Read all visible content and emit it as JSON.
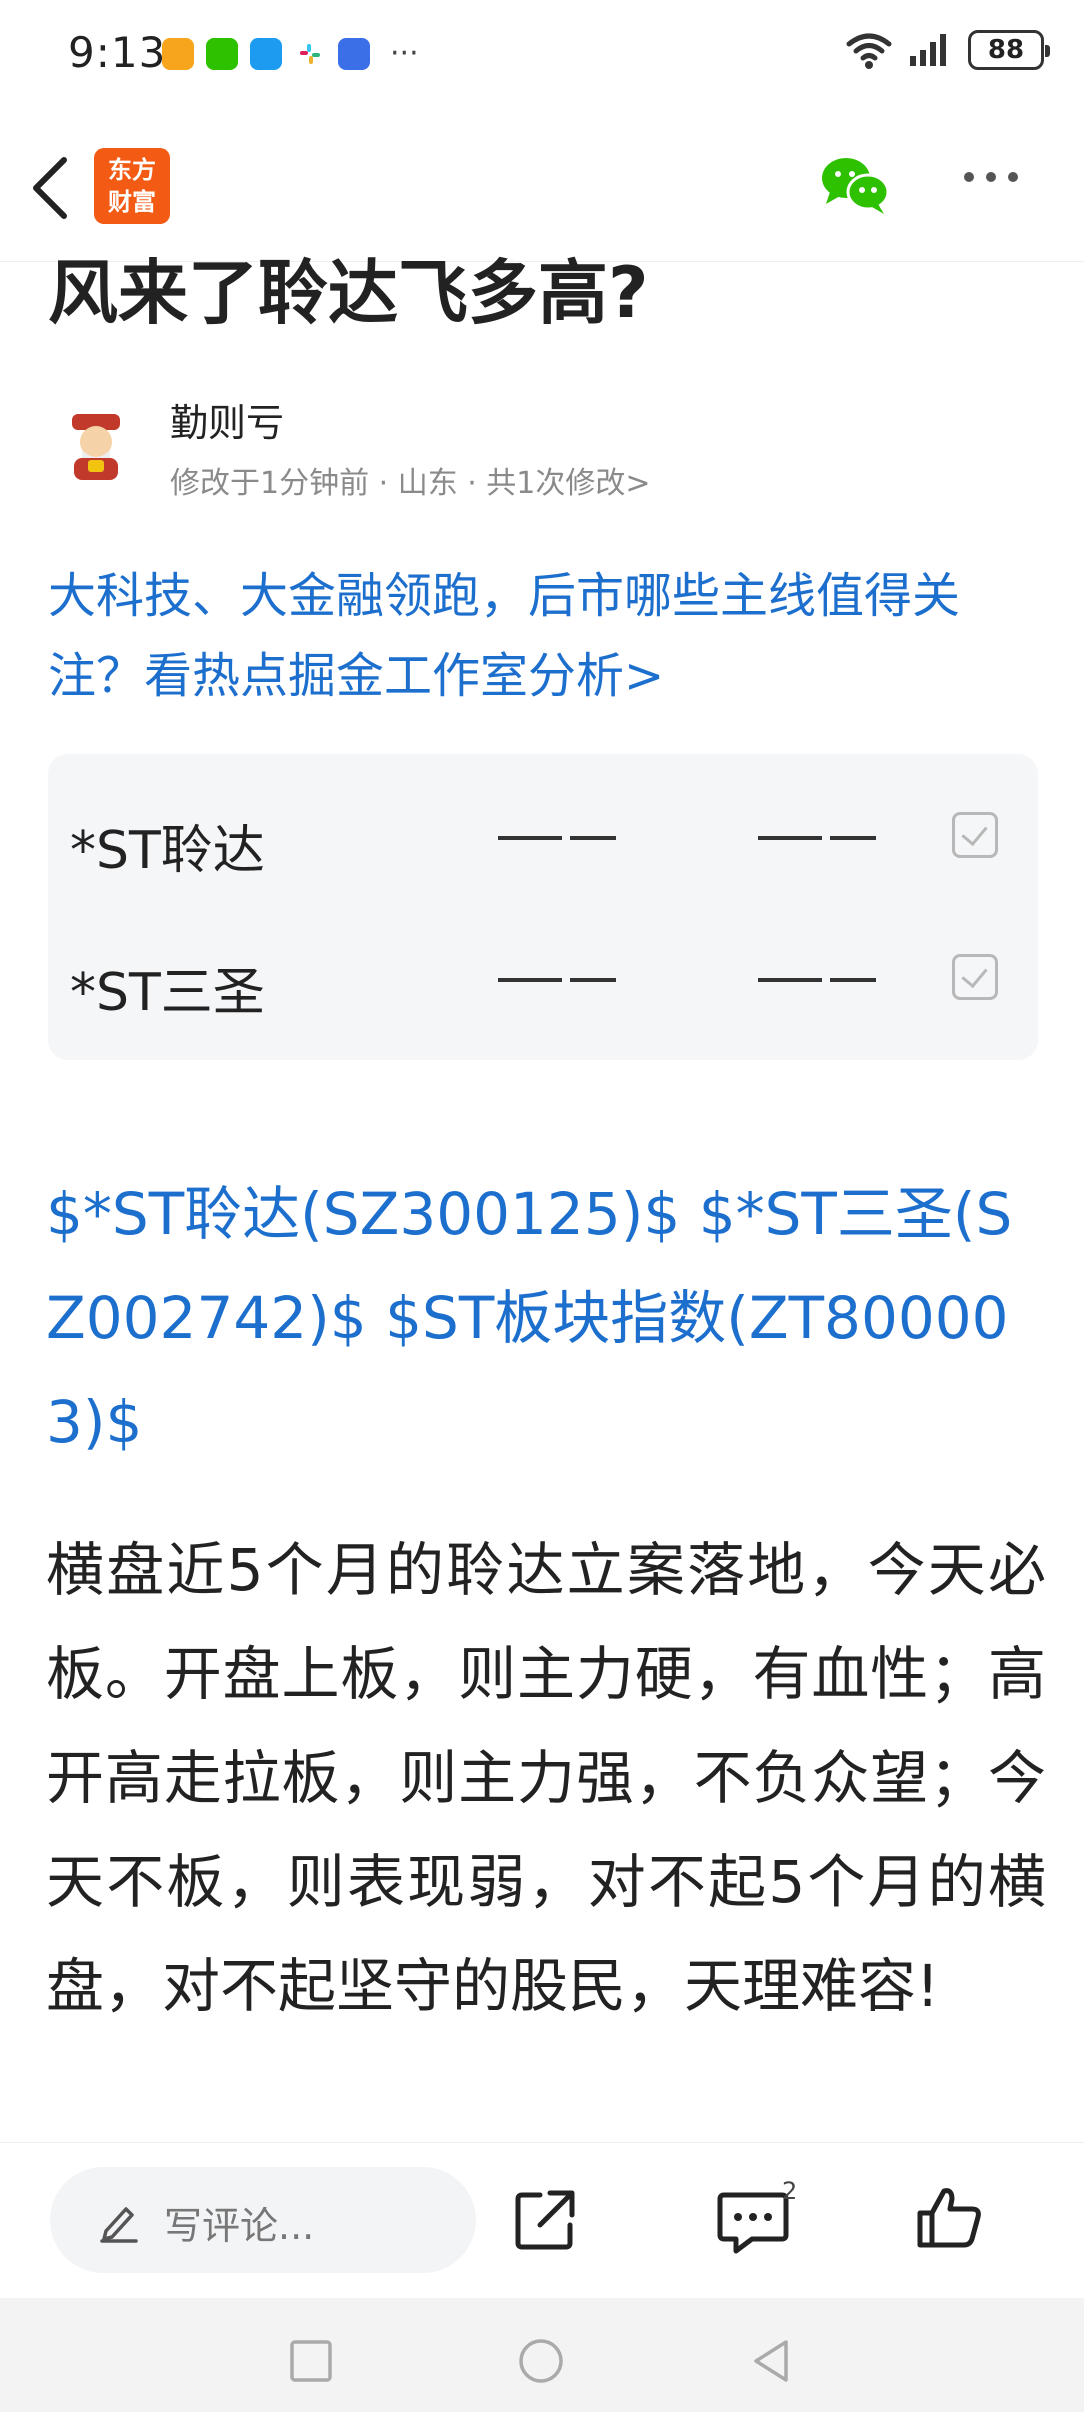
{
  "status_bar": {
    "time": "9:13",
    "battery": "88",
    "more": "···"
  },
  "nav": {
    "logo_line1": "东方",
    "logo_line2": "财富",
    "brand_color": "#f35a14"
  },
  "article": {
    "title": "风来了聆达飞多高?",
    "author": "勤则亏",
    "meta": "修改于1分钟前 · 山东 · 共1次修改>",
    "promo_link": "大科技、大金融领跑，后市哪些主线值得关注？看热点掘金工作室分析>",
    "stocks": [
      {
        "name": "*ST聆达",
        "col1": "——",
        "col2": "——"
      },
      {
        "name": "*ST三圣",
        "col1": "——",
        "col2": "——"
      }
    ],
    "stock_tags": "$*ST聆达(SZ300125)$ $*ST三圣(SZ002742)$ $ST板块指数(ZT800003)$",
    "body": "横盘近5个月的聆达立案落地，今天必板。开盘上板，则主力硬，有血性；高开高走拉板，则主力强，不负众望；今天不板，则表现弱，对不起5个月的横盘，对不起坚守的股民，天理难容!"
  },
  "bottom_bar": {
    "comment_placeholder": "写评论...",
    "comment_count": "2"
  },
  "colors": {
    "link": "#1d6fce",
    "wechat": "#2dc100"
  }
}
